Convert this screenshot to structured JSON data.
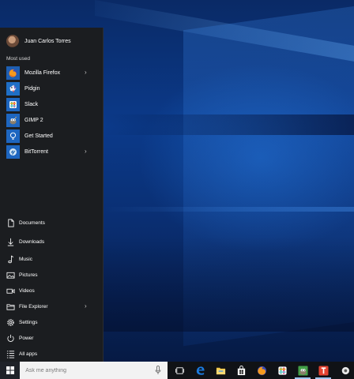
{
  "user": {
    "name": "Juan Carlos Torres"
  },
  "start_menu": {
    "most_used_label": "Most used",
    "apps": [
      {
        "label": "Mozilla Firefox",
        "icon": "firefox-icon",
        "tile_color": "#1e5fb3",
        "has_submenu": true
      },
      {
        "label": "Pidgin",
        "icon": "pidgin-icon",
        "tile_color": "#1f6fc6",
        "has_submenu": false
      },
      {
        "label": "Slack",
        "icon": "slack-icon",
        "tile_color": "#1e66c0",
        "has_submenu": false
      },
      {
        "label": "GIMP 2",
        "icon": "gimp-icon",
        "tile_color": "#1e66c0",
        "has_submenu": false
      },
      {
        "label": "Get Started",
        "icon": "lightbulb-icon",
        "tile_color": "#1e66c0",
        "has_submenu": false
      },
      {
        "label": "BitTorrent",
        "icon": "bittorrent-icon",
        "tile_color": "#1e66c0",
        "has_submenu": true
      }
    ],
    "places": [
      {
        "label": "Documents",
        "icon": "document-icon",
        "has_submenu": false
      },
      {
        "label": "Downloads",
        "icon": "download-icon",
        "has_submenu": false
      },
      {
        "label": "Music",
        "icon": "music-icon",
        "has_submenu": false
      },
      {
        "label": "Pictures",
        "icon": "picture-icon",
        "has_submenu": false
      },
      {
        "label": "Videos",
        "icon": "video-icon",
        "has_submenu": false
      },
      {
        "label": "File Explorer",
        "icon": "folder-icon",
        "has_submenu": true
      },
      {
        "label": "Settings",
        "icon": "gear-icon",
        "has_submenu": false
      },
      {
        "label": "Power",
        "icon": "power-icon",
        "has_submenu": false
      },
      {
        "label": "All apps",
        "icon": "list-icon",
        "has_submenu": false
      }
    ]
  },
  "taskbar": {
    "search_placeholder": "Ask me anything",
    "icons": [
      "task-view-icon",
      "edge-icon",
      "file-explorer-icon",
      "store-icon",
      "firefox-icon",
      "slack-icon",
      "gimp-icon",
      "todoist-icon",
      "partial-app-icon"
    ]
  },
  "colors": {
    "accent": "#0078d7",
    "menu_bg": "#1b1d20",
    "taskbar_bg": "#101216"
  }
}
